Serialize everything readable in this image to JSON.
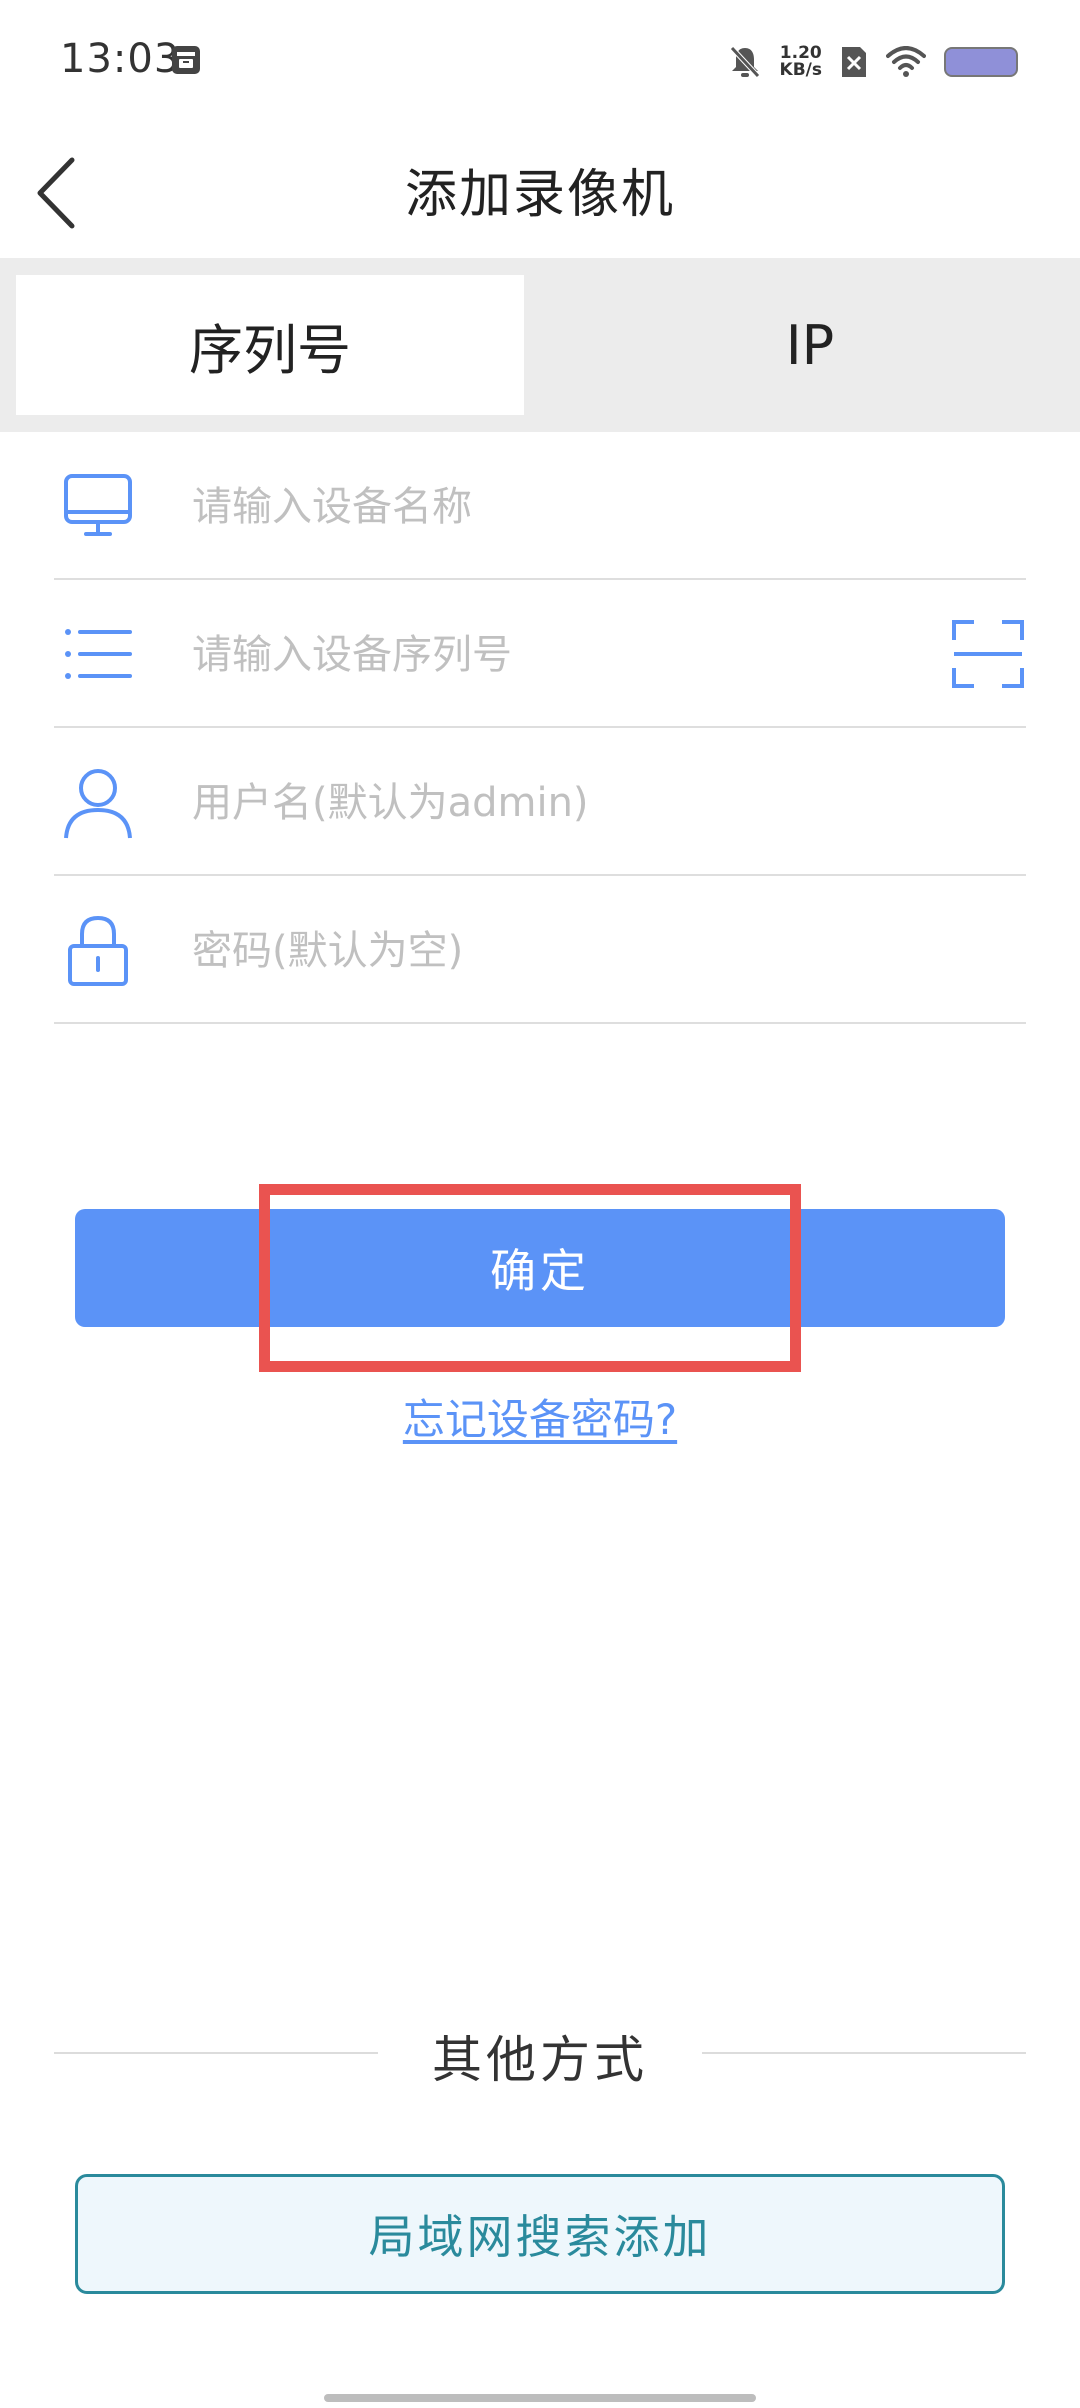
{
  "status_bar": {
    "time": "13:03",
    "net_speed_value": "1.20",
    "net_speed_unit": "KB/s",
    "icons": [
      "app-notification-icon",
      "mute-bell-icon",
      "no-sim-icon",
      "wifi-icon",
      "battery-icon"
    ]
  },
  "header": {
    "title": "添加录像机",
    "back_icon": "chevron-left-icon"
  },
  "tabs": [
    {
      "label": "序列号",
      "selected": true
    },
    {
      "label": "IP",
      "selected": false
    }
  ],
  "form": {
    "device_name": {
      "placeholder": "请输入设备名称",
      "value": "",
      "icon": "monitor-icon"
    },
    "serial_number": {
      "placeholder": "请输入设备序列号",
      "value": "",
      "icon": "list-icon",
      "action_icon": "scan-icon"
    },
    "username": {
      "placeholder": "用户名(默认为admin)",
      "value": "",
      "icon": "user-icon"
    },
    "password": {
      "placeholder": "密码(默认为空)",
      "value": "",
      "icon": "lock-icon"
    }
  },
  "actions": {
    "confirm_label": "确定",
    "forgot_label": "忘记设备密码?"
  },
  "other": {
    "title": "其他方式",
    "lan_search_label": "局域网搜索添加"
  },
  "colors": {
    "accent": "#5b93f7",
    "icon_blue": "#5b93f7",
    "highlight_red": "#ea5350",
    "lan_teal": "#2a8a9c",
    "tab_bar_bg": "#ececec"
  }
}
